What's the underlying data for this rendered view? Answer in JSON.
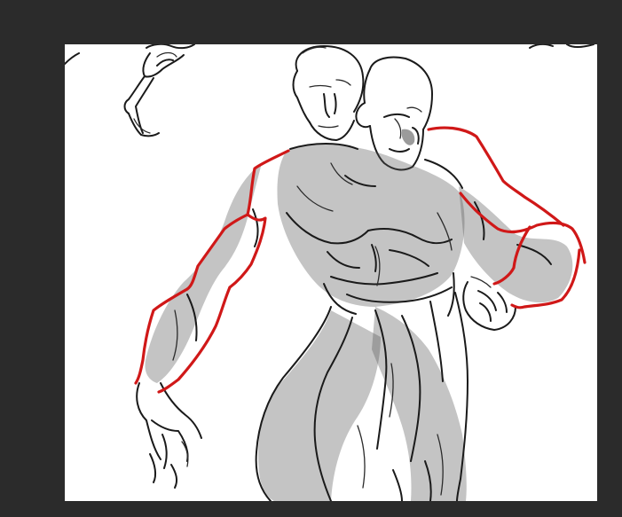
{
  "canvas": {
    "background_color": "#2b2b2b",
    "paper_color": "#ffffff"
  },
  "drawing": {
    "subject": "figure-sketch",
    "ink_color": "#1a1a1a",
    "overlay_color": "#d01818"
  }
}
